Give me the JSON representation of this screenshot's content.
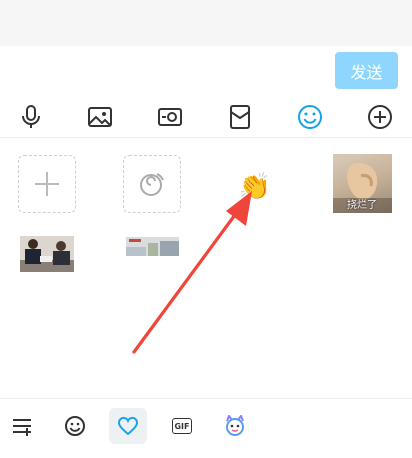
{
  "composer": {
    "send_label": "发送"
  },
  "toolbar": {
    "items": [
      {
        "icon": "microphone-icon"
      },
      {
        "icon": "image-icon"
      },
      {
        "icon": "camera-icon"
      },
      {
        "icon": "red-packet-icon"
      },
      {
        "icon": "emoji-icon",
        "active": true
      },
      {
        "icon": "plus-icon"
      }
    ],
    "active_color": "#12a3e8"
  },
  "stickers": {
    "items": [
      {
        "type": "add"
      },
      {
        "type": "manage"
      },
      {
        "type": "emoji",
        "glyph": "👏"
      },
      {
        "type": "image",
        "caption": "挠烂了"
      },
      {
        "type": "image"
      },
      {
        "type": "image"
      }
    ]
  },
  "bottom_tabs": {
    "items": [
      {
        "icon": "sticker-list-icon"
      },
      {
        "icon": "smiley-icon"
      },
      {
        "icon": "heart-icon",
        "active": true
      },
      {
        "icon": "gif-icon",
        "label": "GIF"
      },
      {
        "icon": "character-icon"
      }
    ],
    "active_color": "#1aa5e8"
  },
  "annotation": {
    "arrow_color": "#f0453a"
  }
}
